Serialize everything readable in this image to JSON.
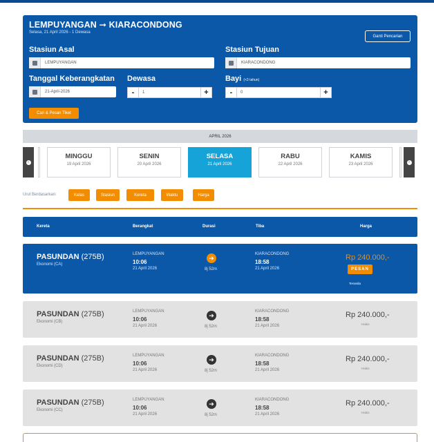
{
  "search": {
    "route": "LEMPUYANGAN ➞ KIARACONDONG",
    "subtitle": "Selasa, 21 April 2026 - 1 Dewasa",
    "change_button": "Ganti Pencarian",
    "origin_label": "Stasiun Asal",
    "origin_value": "LEMPUYANGAN",
    "destination_label": "Stasiun Tujuan",
    "destination_value": "KIARACONDONG",
    "date_label": "Tanggal Keberangkatan",
    "date_value": "21-April-2026",
    "adult_label": "Dewasa",
    "adult_value": "1",
    "infant_label": "Bayi",
    "infant_note": "(<3 tahun)",
    "infant_value": "0",
    "minus": "-",
    "plus": "+",
    "submit_button": "Cari & Pesan Tiket"
  },
  "month": "APRIL 2026",
  "days": [
    {
      "name": "MINGGU",
      "date": "19 April 2026"
    },
    {
      "name": "SENIN",
      "date": "20 April 2026"
    },
    {
      "name": "SELASA",
      "date": "21 April 2026",
      "active": true
    },
    {
      "name": "RABU",
      "date": "22 April 2026"
    },
    {
      "name": "KAMIS",
      "date": "23 April 2026"
    }
  ],
  "sort": {
    "label": "Urut Berdasarkan:",
    "options": [
      "Kelas",
      "Stasiun",
      "Kereta",
      "Waktu",
      "Harga"
    ]
  },
  "table_header": {
    "train": "Kereta",
    "depart": "Berangkat",
    "duration": "Durasi",
    "arrive": "Tiba",
    "price": "Harga"
  },
  "trains": [
    {
      "name": "PASUNDAN",
      "code": "(275B)",
      "class": "Ekonomi (CA)",
      "from": "LEMPUYANGAN",
      "dep_time": "10:06",
      "dep_date": "21 April 2026",
      "duration": "8j 52m",
      "to": "KIARACONDONG",
      "arr_time": "18:58",
      "arr_date": "21 April 2026",
      "price": "Rp 240.000,-",
      "status": "Tersedia",
      "action": "PESAN"
    },
    {
      "name": "PASUNDAN",
      "code": "(275B)",
      "class": "Ekonomi (CB)",
      "from": "LEMPUYANGAN",
      "dep_time": "10:06",
      "dep_date": "21 April 2026",
      "duration": "8j 52m",
      "to": "KIARACONDONG",
      "arr_time": "18:58",
      "arr_date": "21 April 2026",
      "price": "Rp 240.000,-",
      "status": "Habis"
    },
    {
      "name": "PASUNDAN",
      "code": "(275B)",
      "class": "Ekonomi (CD)",
      "from": "LEMPUYANGAN",
      "dep_time": "10:06",
      "dep_date": "21 April 2026",
      "duration": "8j 52m",
      "to": "KIARACONDONG",
      "arr_time": "18:58",
      "arr_date": "21 April 2026",
      "price": "Rp 240.000,-",
      "status": "Habis"
    },
    {
      "name": "PASUNDAN",
      "code": "(275B)",
      "class": "Ekonomi (CC)",
      "from": "LEMPUYANGAN",
      "dep_time": "10:06",
      "dep_date": "21 April 2026",
      "duration": "8j 52m",
      "to": "KIARACONDONG",
      "arr_time": "18:58",
      "arr_date": "21 April 2026",
      "price": "Rp 240.000,-",
      "status": "Habis"
    }
  ],
  "icons": {
    "prev": "chevron-left-icon",
    "next": "chevron-right-icon",
    "arrow": "arrow-right-icon",
    "station": "train-icon",
    "calendar": "calendar-icon"
  },
  "colors": {
    "primary": "#0b57a8",
    "accent": "#f28c00",
    "active_day": "#16a3d8",
    "row_bg": "#e2e2e2"
  }
}
